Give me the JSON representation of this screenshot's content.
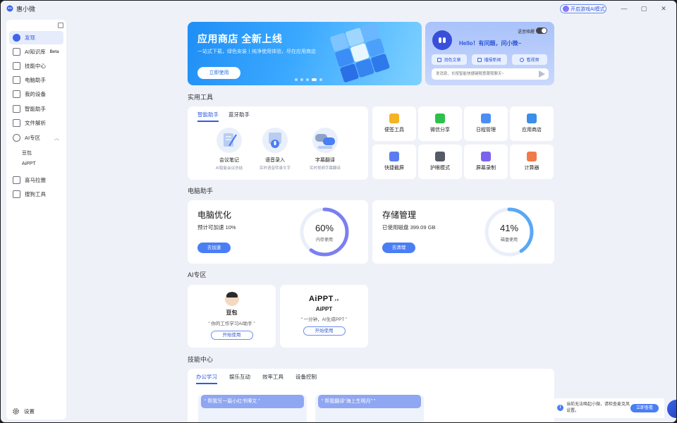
{
  "app": {
    "title": "惠小微"
  },
  "titlebar": {
    "ai_mode_label": "开启游戏AI模式",
    "minimize": "—",
    "maximize": "▢",
    "close": "✕"
  },
  "sidebar": {
    "items": [
      {
        "label": "发现",
        "icon": "discover-icon"
      },
      {
        "label": "AI知识库",
        "badge": "Beta",
        "icon": "knowledge-base-icon"
      },
      {
        "label": "技能中心",
        "icon": "skills-icon"
      },
      {
        "label": "电脑助手",
        "icon": "computer-icon"
      },
      {
        "label": "我的设备",
        "icon": "device-icon"
      },
      {
        "label": "智能助手",
        "icon": "assistant-icon"
      },
      {
        "label": "文件解析",
        "icon": "file-icon"
      },
      {
        "label": "AI专区",
        "icon": "ai-zone-icon"
      }
    ],
    "sub_items": [
      "豆包",
      "AiPPT"
    ],
    "items2": [
      {
        "label": "喜马拉雅",
        "icon": "ximalaya-icon"
      },
      {
        "label": "搜狗工具",
        "icon": "sogou-icon"
      }
    ],
    "settings": "设置"
  },
  "banner": {
    "title": "应用商店 全新上线",
    "subtitle": "一站式下载，绿色安装丨纯净使用体验，尽在应用商店",
    "button": "立即使用",
    "slide_count": 5,
    "active_slide": 3
  },
  "assistant": {
    "greeting": "Hello！有问题，问小微~",
    "voice_wake": "语音唤醒",
    "buttons": [
      "润色文章",
      "播报新闻",
      "看视频"
    ],
    "input_placeholder": "发消息、长按智能快捷键随意跟我聊天~"
  },
  "tools": {
    "section_title": "实用工具",
    "tabs": [
      "智能助手",
      "蓝牙助手"
    ],
    "features": [
      {
        "name": "会议笔记",
        "desc": "AI智能会议总结"
      },
      {
        "name": "语音录入",
        "desc": "实时语音转录文字"
      },
      {
        "name": "字幕翻译",
        "desc": "实时视频字幕翻译"
      }
    ],
    "tiles": [
      {
        "label": "便签工具",
        "icon": "notes-icon",
        "color": "#f5b323"
      },
      {
        "label": "微信分享",
        "icon": "wechat-icon",
        "color": "#2dc14b"
      },
      {
        "label": "日程管理",
        "icon": "calendar-icon",
        "color": "#4a8ef5"
      },
      {
        "label": "应用商店",
        "icon": "app-store-icon",
        "color": "#3a8fe8"
      },
      {
        "label": "快捷截屏",
        "icon": "screenshot-icon",
        "color": "#5b7cf0"
      },
      {
        "label": "护眼模式",
        "icon": "eye-care-icon",
        "color": "#555a66"
      },
      {
        "label": "屏幕录制",
        "icon": "screen-record-icon",
        "color": "#7b63f0"
      },
      {
        "label": "计算器",
        "icon": "calculator-icon",
        "color": "#f07a4a"
      }
    ]
  },
  "pc_helper": {
    "section_title": "电脑助手",
    "optimize": {
      "title": "电脑优化",
      "subtitle": "预计可加速 10%",
      "button": "去加速",
      "gauge_value": "60%",
      "gauge_label": "内存使用",
      "fraction": 0.6
    },
    "storage": {
      "title": "存储管理",
      "subtitle": "已使用磁盘 399.09 GB",
      "button": "去清理",
      "gauge_value": "41%",
      "gauge_label": "磁盘使用",
      "fraction": 0.41
    }
  },
  "ai_zone": {
    "section_title": "AI专区",
    "cards": [
      {
        "name": "豆包",
        "desc": "“ 你的工作学习AI助手 ”",
        "button": "开始使用"
      },
      {
        "name": "AiPPT",
        "logo": "AiPPT",
        "logo_suffix": ".cn",
        "desc": "“ 一分钟，AI生成PPT ”",
        "button": "开始使用"
      }
    ]
  },
  "skills": {
    "section_title": "技能中心",
    "tabs": [
      "办公学习",
      "娱乐互动",
      "效率工具",
      "设备控制"
    ],
    "prompts": [
      "“ 帮我写一篇小红书博文 ”",
      "“ 帮我翻译“海上生明月” ”"
    ]
  },
  "toast": {
    "text": "当前无法唤起小微，请检查麦克风设置。",
    "button": "立即查看"
  },
  "colors": {
    "accent": "#2f5ce0",
    "button_blue": "#4a7ef5",
    "background": "#eef1f8"
  }
}
